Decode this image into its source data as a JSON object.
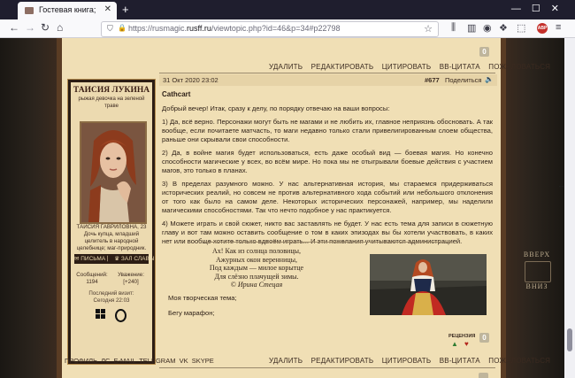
{
  "browser": {
    "tab_title": "Гостевая книга;",
    "url_prefix": "https://rusmagic.",
    "url_domain": "rusff.ru",
    "url_path": "/viewtopic.php?id=46&p=34#p22798"
  },
  "top_actions": [
    "УДАЛИТЬ",
    "РЕДАКТИРОВАТЬ",
    "ЦИТИРОВАТЬ",
    "ВВ-ЦИТАТА",
    "ПОЖАЛОВАТЬСЯ"
  ],
  "top_counter": "0",
  "author": {
    "name": "ТАИСИЯ ЛУКИНА",
    "status": "рыжая девочка на зеленой траве",
    "info": "ТАИСИЯ ГАВРИЛОВНА, 23 Дочь купца, младший целитель в народной целебнице; маг-природник.",
    "links": "✉ ПИСЬМА ⎸ ♛ ЗАЛ СЛАВЫ",
    "messages_label": "Сообщений:",
    "messages_value": "1194",
    "respect_label": "Уважение:",
    "respect_value": "[+240]",
    "last_visit_label": "Последний визит:",
    "last_visit_value": "Сегодня 22:03"
  },
  "post": {
    "date": "31 Окт 2020 23:02",
    "number": "#677",
    "share": "Поделиться",
    "title": "Cathcart",
    "paragraphs": [
      "Добрый вечер! Итак, сразу к делу, по порядку отвечаю на ваши вопросы:",
      "1) Да, всё верно. Персонажи могут быть не магами и не любить их, главное неприязнь обосновать. А так вообще, если почитаете матчасть, то маги недавно только стали привелигированным слоем общества, раньше они скрывали свои способности.",
      "2) Да, в войне магия будет использоваться, есть даже особый вид — боевая магия. Но конечно способности магические у всех, во всём мире. Но пока мы не отыгрывали боевые действия с участием магов, это только в планах.",
      "3) В пределах разумного можно. У нас альтернативная история, мы стараемся придерживаться исторических реалий, но совсем не против альтернативного хода событий или небольшого отклонения от того как было на самом деле. Некоторых исторических персонажей, например, мы наделили магическими способностями. Так что нечто подобное у нас практикуется.",
      "4) Можете играть и свой сюжет, никто вас заставлять не будет. У нас есть тема для записи в сюжетную главу и вот там можно оставить сообщение о том в каких эпизодах вы бы хотели участвовать, в каких нет или вообще хотите только вдвоём играть... И эти пожелания учитываются администрацией."
    ],
    "poem": [
      "Ах! Как из солнца половицы,",
      "Ажурных окон веренницы,",
      "Под каждым — милое корытце",
      "Для слёзно плачущей зимы.",
      "© Ирина Стецая"
    ],
    "signature_lines": [
      "Моя творческая тема;",
      "Бегу марафон;"
    ],
    "reputation_label": "РЕЦЕНЗИЯ",
    "like_counter": "0"
  },
  "profile_links": [
    "ПРОФИЛЬ",
    "ЛС",
    "E-MAIL",
    "TELEGRAM",
    "VK",
    "SKYPE"
  ],
  "bottom_actions": [
    "УДАЛИТЬ",
    "РЕДАКТИРОВАТЬ",
    "ЦИТИРОВАТЬ",
    "ВВ-ЦИТАТА",
    "ПОЖАЛОВАТЬСЯ"
  ],
  "nav_widget": {
    "up": "ВВЕРХ",
    "down": "ВНИЗ"
  },
  "colors": {
    "parchment": "#f0dfb5",
    "frame": "#5a3c24",
    "ink": "#2d1f16",
    "chrome_dark": "#1f1e2e"
  }
}
